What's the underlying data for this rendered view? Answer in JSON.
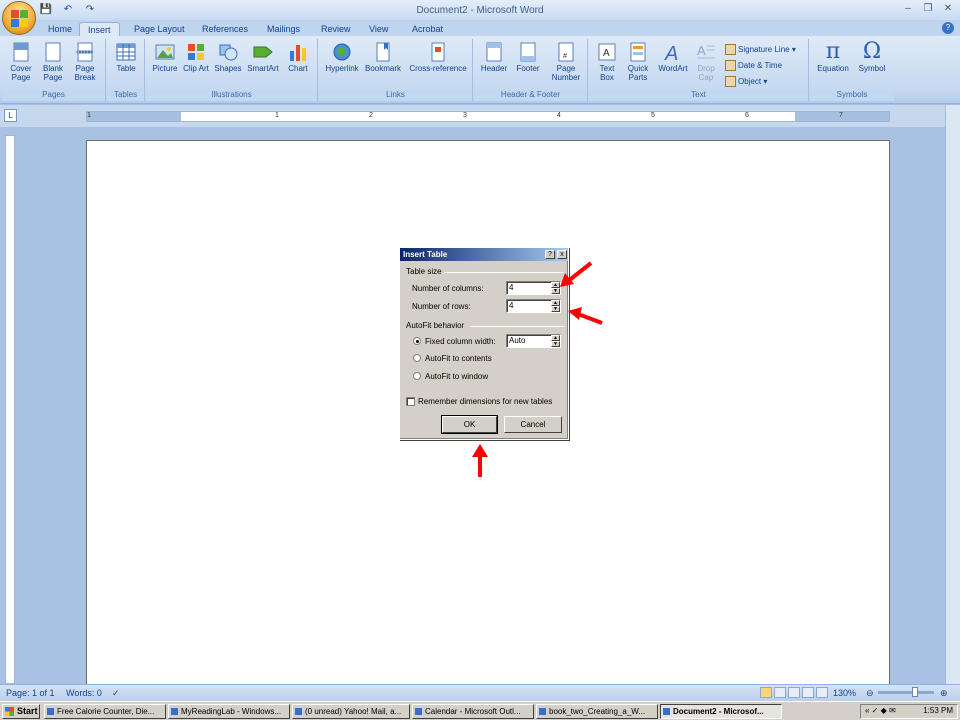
{
  "window": {
    "title": "Document2 - Microsoft Word"
  },
  "qat": {
    "save": "💾",
    "undo": "↶",
    "redo": "↷"
  },
  "tabs": [
    "Home",
    "Insert",
    "Page Layout",
    "References",
    "Mailings",
    "Review",
    "View",
    "Acrobat"
  ],
  "ribbon": {
    "groups": [
      "Pages",
      "Tables",
      "Illustrations",
      "Links",
      "Header & Footer",
      "Text",
      "Symbols"
    ],
    "pages": {
      "cover": "Cover Page",
      "blank": "Blank Page",
      "break": "Page Break"
    },
    "tables": {
      "table": "Table"
    },
    "illustrations": {
      "picture": "Picture",
      "clipart": "Clip Art",
      "shapes": "Shapes",
      "smartart": "SmartArt",
      "chart": "Chart"
    },
    "links": {
      "hyperlink": "Hyperlink",
      "bookmark": "Bookmark",
      "crossref": "Cross-reference"
    },
    "headerfooter": {
      "header": "Header",
      "footer": "Footer",
      "pagenumber": "Page Number"
    },
    "text": {
      "textbox": "Text Box",
      "quickparts": "Quick Parts",
      "wordart": "WordArt",
      "dropcap": "Drop Cap",
      "signature": "Signature Line",
      "datetime": "Date & Time",
      "object": "Object"
    },
    "symbols": {
      "equation": "Equation",
      "symbol": "Symbol",
      "pi": "π",
      "omega": "Ω"
    }
  },
  "ruler": {
    "numbers": [
      "1",
      "1",
      "2",
      "3",
      "4",
      "5",
      "6",
      "7"
    ]
  },
  "dialog": {
    "title": "Insert Table",
    "help_btn": "?",
    "close_btn": "x",
    "table_size_label": "Table size",
    "columns_label": "Number of columns:",
    "columns_value": "4",
    "rows_label": "Number of rows:",
    "rows_value": "4",
    "autofit_label": "AutoFit behavior",
    "fixed_label": "Fixed column width:",
    "fixed_value": "Auto",
    "autofit_contents": "AutoFit to contents",
    "autofit_window": "AutoFit to window",
    "remember_label": "Remember dimensions for new tables",
    "ok": "OK",
    "cancel": "Cancel"
  },
  "statusbar": {
    "page": "Page: 1 of 1",
    "words": "Words: 0",
    "zoom": "130%"
  },
  "taskbar": {
    "start": "Start",
    "tasks": [
      "Free Calorie Counter, Die...",
      "MyReadingLab - Windows...",
      "(0 unread) Yahoo! Mail, a...",
      "Calendar - Microsoft Outl...",
      "book_two_Creating_a_W...",
      "Document2 - Microsof..."
    ],
    "time": "1:53 PM"
  },
  "colors": {
    "arrow": "#ff0000",
    "title_bar": "#0a246a"
  }
}
